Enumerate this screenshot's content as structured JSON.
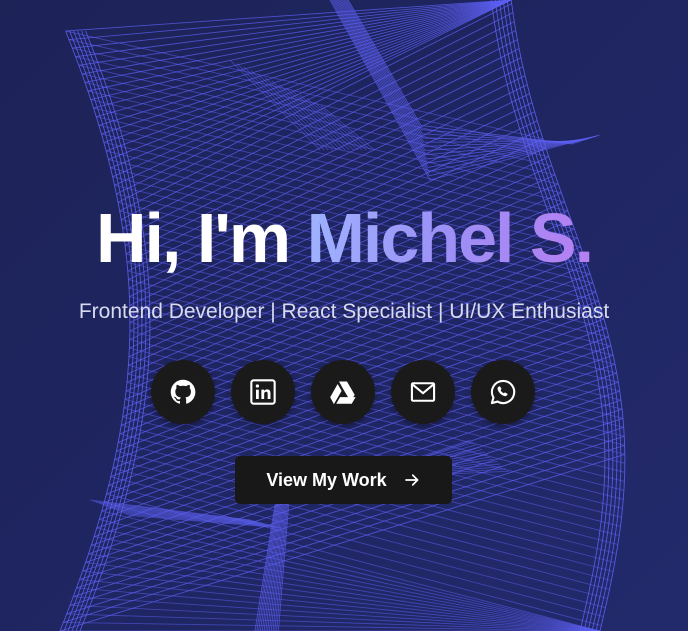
{
  "hero": {
    "greeting": "Hi, I'm ",
    "name": "Michel S.",
    "subtitle": "Frontend Developer | React Specialist | UI/UX Enthusiast",
    "cta_label": "View My Work",
    "cta_icon": "arrow-right-icon"
  },
  "socials": [
    {
      "icon": "github-icon",
      "label": "GitHub"
    },
    {
      "icon": "linkedin-icon",
      "label": "LinkedIn"
    },
    {
      "icon": "google-drive-icon",
      "label": "Google Drive"
    },
    {
      "icon": "mail-icon",
      "label": "Email"
    },
    {
      "icon": "whatsapp-icon",
      "label": "WhatsApp"
    }
  ],
  "colors": {
    "background": "#1f2560",
    "wireframe": "#5c5ff0",
    "name_gradient_start": "#9eb2ff",
    "name_gradient_end": "#b67ff2",
    "button_bg": "#181818",
    "text": "#ffffff",
    "subtitle": "#d8dbef"
  }
}
